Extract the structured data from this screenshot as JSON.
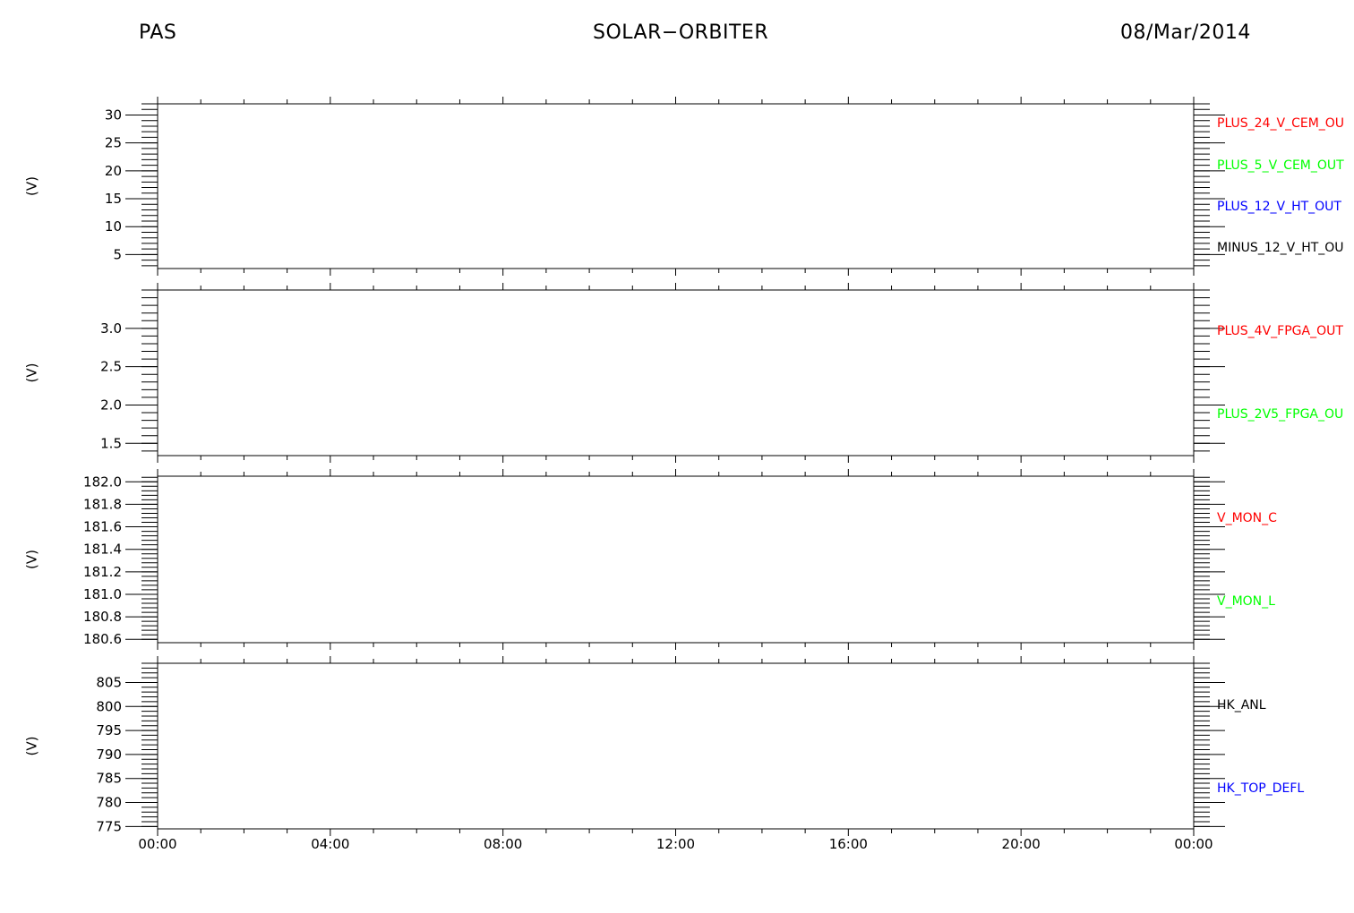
{
  "header": {
    "left": "PAS",
    "center": "SOLAR−ORBITER",
    "right": "08/Mar/2014"
  },
  "colors": {
    "red": "#ff0000",
    "green": "#00ff00",
    "blue": "#0000ff",
    "black": "#000000"
  },
  "chart_data": [
    {
      "type": "line",
      "ylabel": "(V)",
      "ylim": [
        2.5,
        32
      ],
      "yticks": [
        5,
        10,
        15,
        20,
        25,
        30
      ],
      "ytick_labels": [
        "5",
        "10",
        "15",
        "20",
        "25",
        "30"
      ],
      "minor_step": 1,
      "x_tick_labels": [
        "00:00",
        "04:00",
        "08:00",
        "12:00",
        "16:00",
        "20:00",
        "00:00"
      ],
      "series": [
        {
          "name": "PLUS_24_V_CEM_OU",
          "color": "red",
          "values": []
        },
        {
          "name": "PLUS_5_V_CEM_OUT",
          "color": "green",
          "values": []
        },
        {
          "name": "PLUS_12_V_HT_OUT",
          "color": "blue",
          "values": []
        },
        {
          "name": "MINUS_12_V_HT_OU",
          "color": "black",
          "values": []
        }
      ]
    },
    {
      "type": "line",
      "ylabel": "(V)",
      "ylim": [
        1.34,
        3.5
      ],
      "yticks": [
        1.5,
        2.0,
        2.5,
        3.0
      ],
      "ytick_labels": [
        "1.5",
        "2.0",
        "2.5",
        "3.0"
      ],
      "minor_step": 0.1,
      "x_tick_labels": [
        "00:00",
        "04:00",
        "08:00",
        "12:00",
        "16:00",
        "20:00",
        "00:00"
      ],
      "series": [
        {
          "name": "PLUS_4V_FPGA_OUT",
          "color": "red",
          "values": []
        },
        {
          "name": "PLUS_2V5_FPGA_OU",
          "color": "green",
          "values": []
        }
      ]
    },
    {
      "type": "line",
      "ylabel": "(V)",
      "ylim": [
        180.57,
        182.05
      ],
      "yticks": [
        180.6,
        180.8,
        181.0,
        181.2,
        181.4,
        181.6,
        181.8,
        182.0
      ],
      "ytick_labels": [
        "180.6",
        "180.8",
        "181.0",
        "181.2",
        "181.4",
        "181.6",
        "181.8",
        "182.0"
      ],
      "minor_step": 0.04,
      "x_tick_labels": [
        "00:00",
        "04:00",
        "08:00",
        "12:00",
        "16:00",
        "20:00",
        "00:00"
      ],
      "series": [
        {
          "name": "V_MON_C",
          "color": "red",
          "values": []
        },
        {
          "name": "V_MON_L",
          "color": "green",
          "values": []
        }
      ]
    },
    {
      "type": "line",
      "ylabel": "(V)",
      "ylim": [
        774.5,
        809
      ],
      "yticks": [
        775,
        780,
        785,
        790,
        795,
        800,
        805
      ],
      "ytick_labels": [
        "775",
        "780",
        "785",
        "790",
        "795",
        "800",
        "805"
      ],
      "minor_step": 1,
      "x_tick_labels": [
        "00:00",
        "04:00",
        "08:00",
        "12:00",
        "16:00",
        "20:00",
        "00:00"
      ],
      "series": [
        {
          "name": "HK_ANL",
          "color": "black",
          "values": []
        },
        {
          "name": "HK_TOP_DEFL",
          "color": "blue",
          "values": []
        }
      ]
    }
  ]
}
